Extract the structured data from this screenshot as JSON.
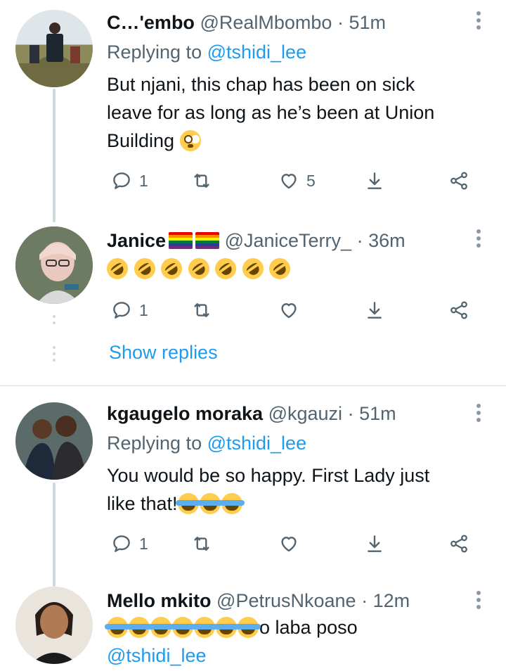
{
  "tweets": [
    {
      "name": "C…'embo",
      "handle": "@RealMbombo",
      "sep": "·",
      "time": "51m",
      "replying_prefix": "Replying to ",
      "replying_to": "@tshidi_lee",
      "text_line1": "But njani, this chap has been on sick",
      "text_line2": "leave for as long as he’s been at Union",
      "text_line3": "Building",
      "emoji": "flushed-face",
      "reply_count": "1",
      "retweet_count": "",
      "like_count": "5"
    },
    {
      "name": "Janice",
      "flags": "rainbow-flag rainbow-flag",
      "handle": "@JaniceTerry_",
      "sep": "·",
      "time": "36m",
      "emoji": "rolling-on-floor-laughing x7",
      "reply_count": "1",
      "retweet_count": "",
      "like_count": ""
    },
    {
      "name": "kgaugelo moraka",
      "handle": "@kgauzi",
      "sep": "·",
      "time": "51m",
      "replying_prefix": "Replying to ",
      "replying_to": "@tshidi_lee",
      "text_line1": "You would be so happy. First Lady just",
      "text_line2": "like that!",
      "emoji": "face-with-tears-of-joy x3",
      "reply_count": "1",
      "retweet_count": "",
      "like_count": ""
    },
    {
      "name": "Mello mkito",
      "handle": "@PetrusNkoane",
      "sep": "·",
      "time": "12m",
      "emoji": "face-with-tears-of-joy x7",
      "text_after_emoji": "o laba poso",
      "mention": "@tshidi_lee"
    }
  ],
  "show_replies": "Show replies",
  "colors": {
    "accent": "#1d9bf0",
    "secondary_text": "#536471",
    "thread_line": "#cfd9de"
  },
  "icons": [
    "reply-icon",
    "retweet-icon",
    "like-icon",
    "download-icon",
    "share-icon",
    "more-icon"
  ]
}
